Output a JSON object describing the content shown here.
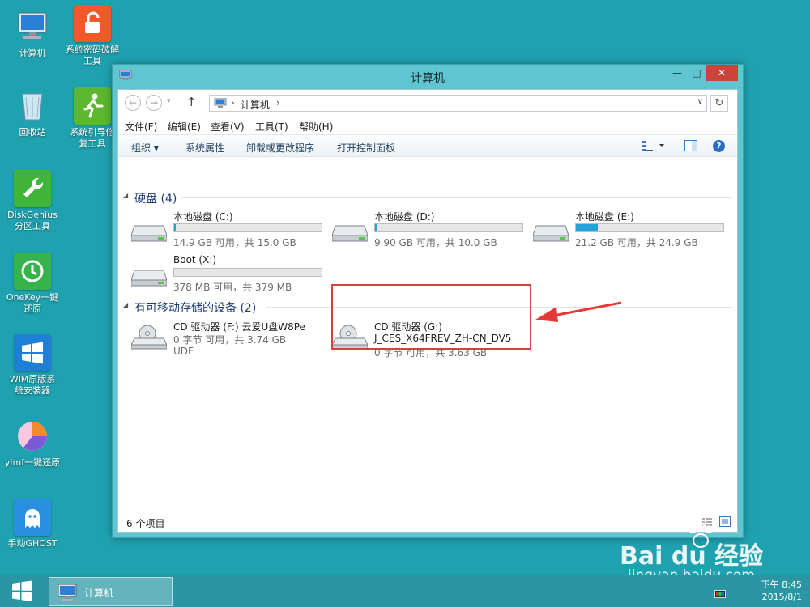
{
  "desktop": {
    "icons": [
      {
        "label": "计算机"
      },
      {
        "label": "系统密码破解\n工具"
      },
      {
        "label": "回收站"
      },
      {
        "label": "系统引导修\n复工具"
      },
      {
        "label": "DiskGenius\n分区工具"
      },
      {
        "label": "OneKey一键\n还原"
      },
      {
        "label": "WIM原版系\n统安装器"
      },
      {
        "label": "ylmf一键还原"
      },
      {
        "label": "手动GHOST"
      }
    ]
  },
  "window": {
    "title": "计算机",
    "controls": {
      "minimize": "—",
      "maximize": "□",
      "close": "✕"
    },
    "address": {
      "path": "计算机",
      "separator": "›"
    },
    "menu": [
      "文件(F)",
      "编辑(E)",
      "查看(V)",
      "工具(T)",
      "帮助(H)"
    ],
    "commands": [
      "组织 ▾",
      "系统属性",
      "卸载或更改程序",
      "打开控制面板"
    ],
    "groups": {
      "hard_disks": {
        "title": "硬盘 (4)",
        "drives": [
          {
            "name": "本地磁盘 (C:)",
            "free": "14.9 GB 可用，共 15.0 GB",
            "used_fraction": 0.01
          },
          {
            "name": "本地磁盘 (D:)",
            "free": "9.90 GB 可用，共 10.0 GB",
            "used_fraction": 0.01
          },
          {
            "name": "本地磁盘 (E:)",
            "free": "21.2 GB 可用，共 24.9 GB",
            "used_fraction": 0.15
          },
          {
            "name": "Boot (X:)",
            "free": "378 MB 可用，共 379 MB",
            "used_fraction": 0.0
          }
        ]
      },
      "removable": {
        "title": "有可移动存储的设备 (2)",
        "drives": [
          {
            "name": "CD 驱动器 (F:) 云爱U盘W8Pe",
            "free": "0 字节 可用，共 3.74 GB",
            "fs": "UDF"
          },
          {
            "name": "CD 驱动器 (G:)",
            "label": "J_CES_X64FREV_ZH-CN_DV5",
            "free": "0 字节 可用，共 3.63 GB"
          }
        ]
      }
    },
    "status": "6 个项目"
  },
  "taskbar": {
    "task_label": "计算机",
    "time": "下午 8:45",
    "date": "2015/8/1"
  },
  "watermark": {
    "brand": "Bai du 经验",
    "url": "jingyan.baidu.com"
  },
  "colors": {
    "desktop": "#1fa2b0",
    "accent_bar": "#26a0da",
    "highlight": "#d6403d"
  }
}
